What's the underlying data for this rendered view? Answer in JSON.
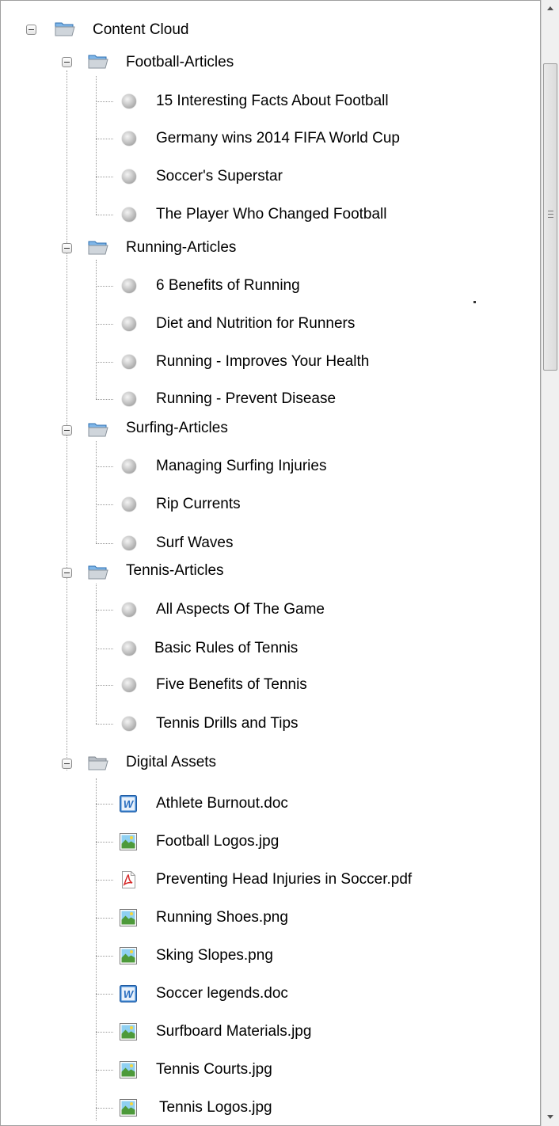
{
  "tree": {
    "root": {
      "label": "Content Cloud"
    },
    "folders": [
      {
        "label": "Football-Articles",
        "items": [
          "15 Interesting Facts About Football",
          "Germany wins 2014 FIFA World Cup",
          "Soccer's Superstar",
          "The Player Who Changed Football"
        ]
      },
      {
        "label": "Running-Articles",
        "items": [
          "6 Benefits of Running",
          "Diet and Nutrition for Runners",
          "Running - Improves Your Health",
          "Running - Prevent Disease"
        ]
      },
      {
        "label": "Surfing-Articles",
        "items": [
          "Managing Surfing Injuries",
          "Rip Currents",
          "Surf Waves"
        ]
      },
      {
        "label": "Tennis-Articles",
        "items": [
          "All Aspects Of The Game",
          "Basic Rules of Tennis",
          "Five Benefits of Tennis",
          "Tennis Drills and Tips"
        ]
      },
      {
        "label": "Digital Assets",
        "items": [
          {
            "name": "Athlete Burnout.doc",
            "icon": "word-doc-icon"
          },
          {
            "name": "Football Logos.jpg",
            "icon": "image-file-icon"
          },
          {
            "name": "Preventing Head Injuries in Soccer.pdf",
            "icon": "pdf-icon"
          },
          {
            "name": "Running Shoes.png",
            "icon": "image-file-icon"
          },
          {
            "name": "Sking Slopes.png",
            "icon": "image-file-icon"
          },
          {
            "name": "Soccer legends.doc",
            "icon": "word-doc-icon"
          },
          {
            "name": "Surfboard Materials.jpg",
            "icon": "image-file-icon"
          },
          {
            "name": "Tennis Courts.jpg",
            "icon": "image-file-icon"
          },
          {
            "name": "Tennis Logos.jpg",
            "icon": "image-file-icon"
          }
        ]
      }
    ]
  },
  "colors": {
    "folder_blue": "#3a8ed6",
    "word_blue": "#2a6ebf",
    "pdf_red": "#d62a2a",
    "image_green": "#4d9a3a"
  }
}
